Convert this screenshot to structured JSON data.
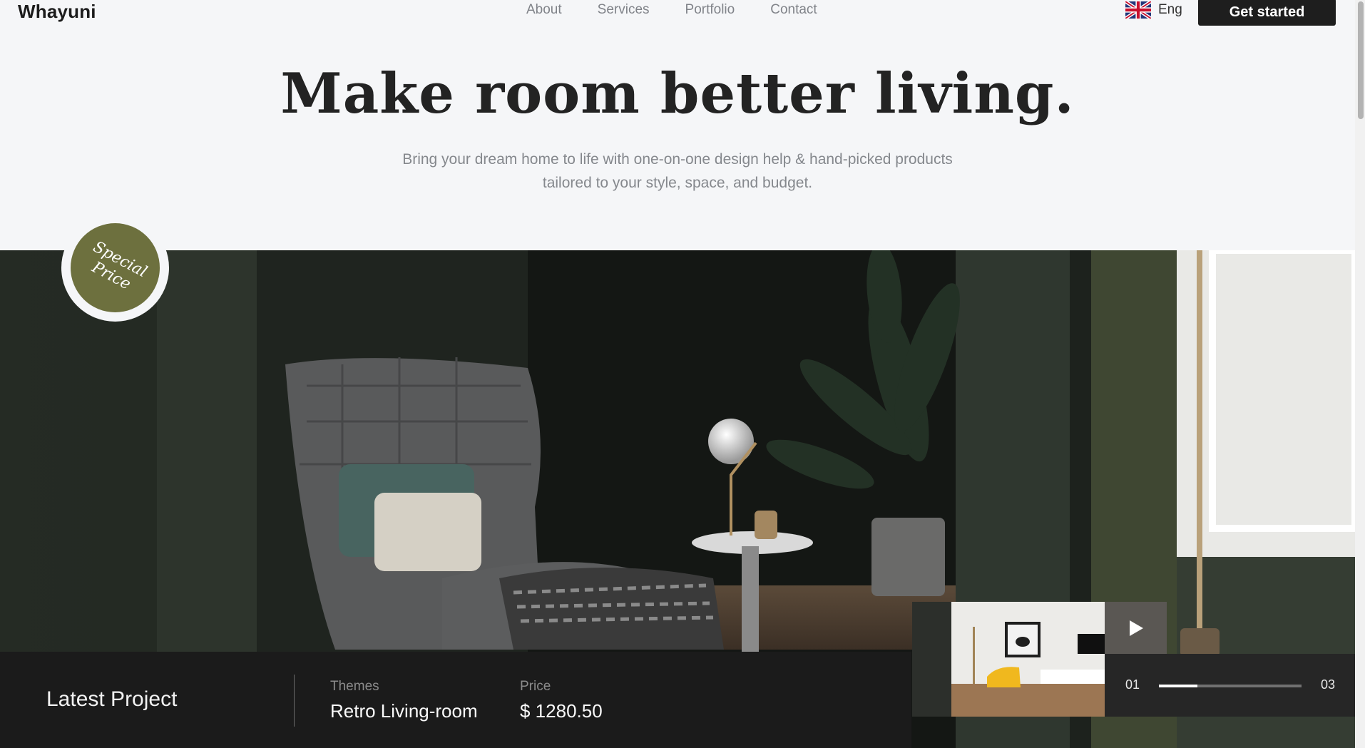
{
  "header": {
    "logo": "Whayuni",
    "nav": [
      "About",
      "Services",
      "Portfolio",
      "Contact"
    ],
    "language": {
      "label": "Eng",
      "flag_icon": "uk-flag-icon"
    },
    "cta_label": "Get started"
  },
  "hero": {
    "title": "Make room better living.",
    "subtitle": "Bring your dream home to life with one-on-one design help & hand-picked products tailored to your style, space, and budget."
  },
  "badge": {
    "text": "Special\nPrice",
    "color": "#6d703e"
  },
  "project": {
    "heading": "Latest Project",
    "themes_label": "Themes",
    "themes_value": "Retro Living-room",
    "price_label": "Price",
    "price_value": "$ 1280.50"
  },
  "slider": {
    "current": "01",
    "total": "03",
    "progress": 0.27,
    "play_icon": "play-icon"
  },
  "colors": {
    "accent_dark": "#1e1e1e",
    "badge_olive": "#6d703e",
    "background": "#f5f6f8"
  }
}
